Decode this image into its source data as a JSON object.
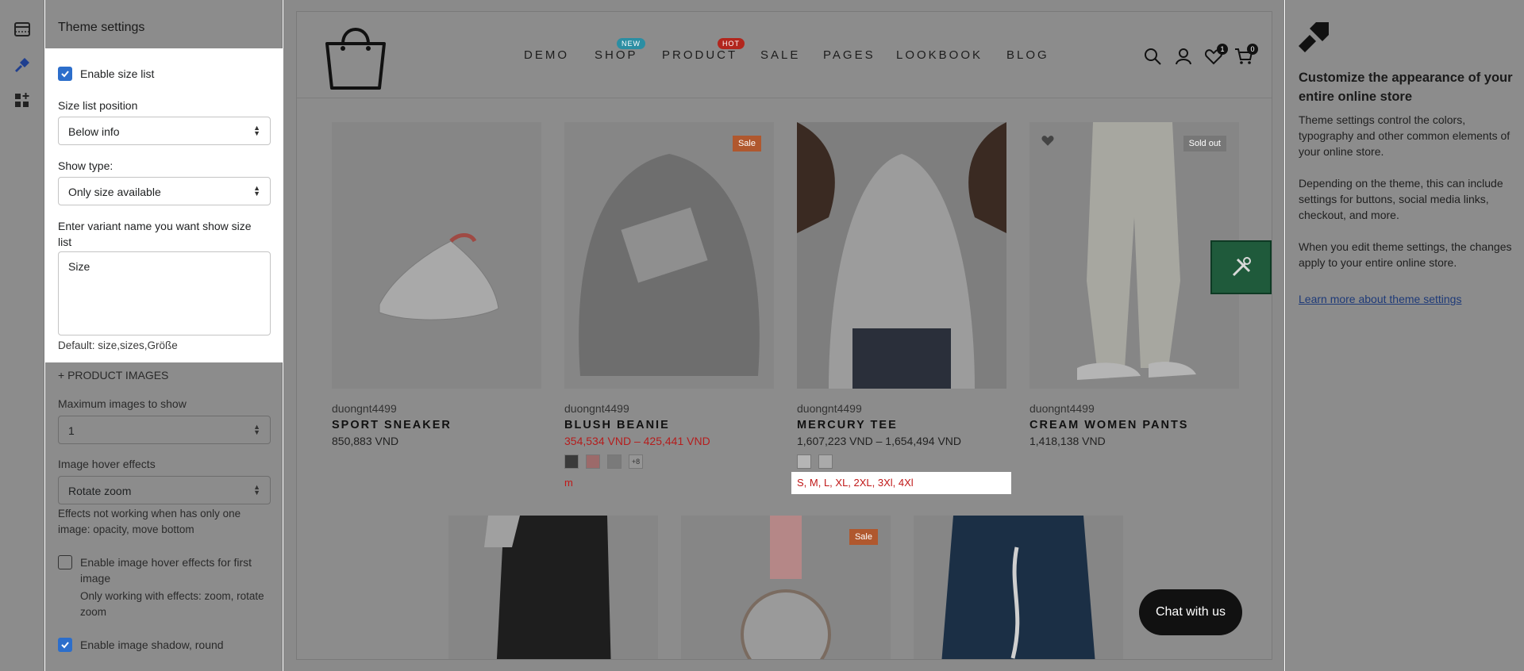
{
  "rail": {
    "icons": [
      "sections-icon",
      "theme-settings-icon",
      "apps-icon"
    ]
  },
  "panel": {
    "title": "Theme settings",
    "enable_size_list": {
      "label": "Enable size list",
      "checked": true
    },
    "size_list_position": {
      "label": "Size list position",
      "value": "Below info"
    },
    "show_type": {
      "label": "Show type:",
      "value": "Only size available"
    },
    "variant_name": {
      "label": "Enter variant name you want show size list",
      "value": "Size",
      "help": "Default: size,sizes,Größe"
    },
    "product_images_header": "+ PRODUCT IMAGES",
    "max_images": {
      "label": "Maximum images to show",
      "value": "1"
    },
    "hover_effects": {
      "label": "Image hover effects",
      "value": "Rotate zoom",
      "help": "Effects not working when has only one image: opacity, move bottom"
    },
    "hover_first_image": {
      "label": "Enable image hover effects for first image",
      "checked": false,
      "help": "Only working with effects: zoom, rotate zoom"
    },
    "shadow_round": {
      "label": "Enable image shadow, round",
      "checked": true
    }
  },
  "preview": {
    "nav": [
      {
        "label": "DEMO"
      },
      {
        "label": "SHOP",
        "badge": "NEW",
        "badge_color": "#2b8ea3"
      },
      {
        "label": "PRODUCT",
        "badge": "HOT",
        "badge_color": "#b2261d"
      },
      {
        "label": "SALE"
      },
      {
        "label": "PAGES"
      },
      {
        "label": "LOOKBOOK"
      },
      {
        "label": "BLOG"
      }
    ],
    "wishlist_count": "1",
    "cart_count": "0",
    "products": [
      {
        "vendor": "duongnt4499",
        "name": "SPORT SNEAKER",
        "price": "850,883 VND"
      },
      {
        "vendor": "duongnt4499",
        "name": "BLUSH BEANIE",
        "price": "354,534 VND – 425,441 VND",
        "badge": "Sale",
        "swatch_more": "+8",
        "size": "m"
      },
      {
        "vendor": "duongnt4499",
        "name": "MERCURY TEE",
        "price": "1,607,223 VND – 1,654,494 VND",
        "size": "S, M, L, XL, 2XL, 3Xl, 4Xl"
      },
      {
        "vendor": "duongnt4499",
        "name": "CREAM WOMEN PANTS",
        "price": "1,418,138 VND",
        "badge": "Sold out"
      }
    ],
    "row2_badge": "Sale",
    "chat_label": "Chat with us"
  },
  "info": {
    "title": "Customize the appearance of your entire online store",
    "p1": "Theme settings control the colors, typography and other common elements of your online store.",
    "p2": "Depending on the theme, this can include settings for buttons, social media links, checkout, and more.",
    "p3": "When you edit theme settings, the changes apply to your entire online store.",
    "link": "Learn more about theme settings"
  }
}
